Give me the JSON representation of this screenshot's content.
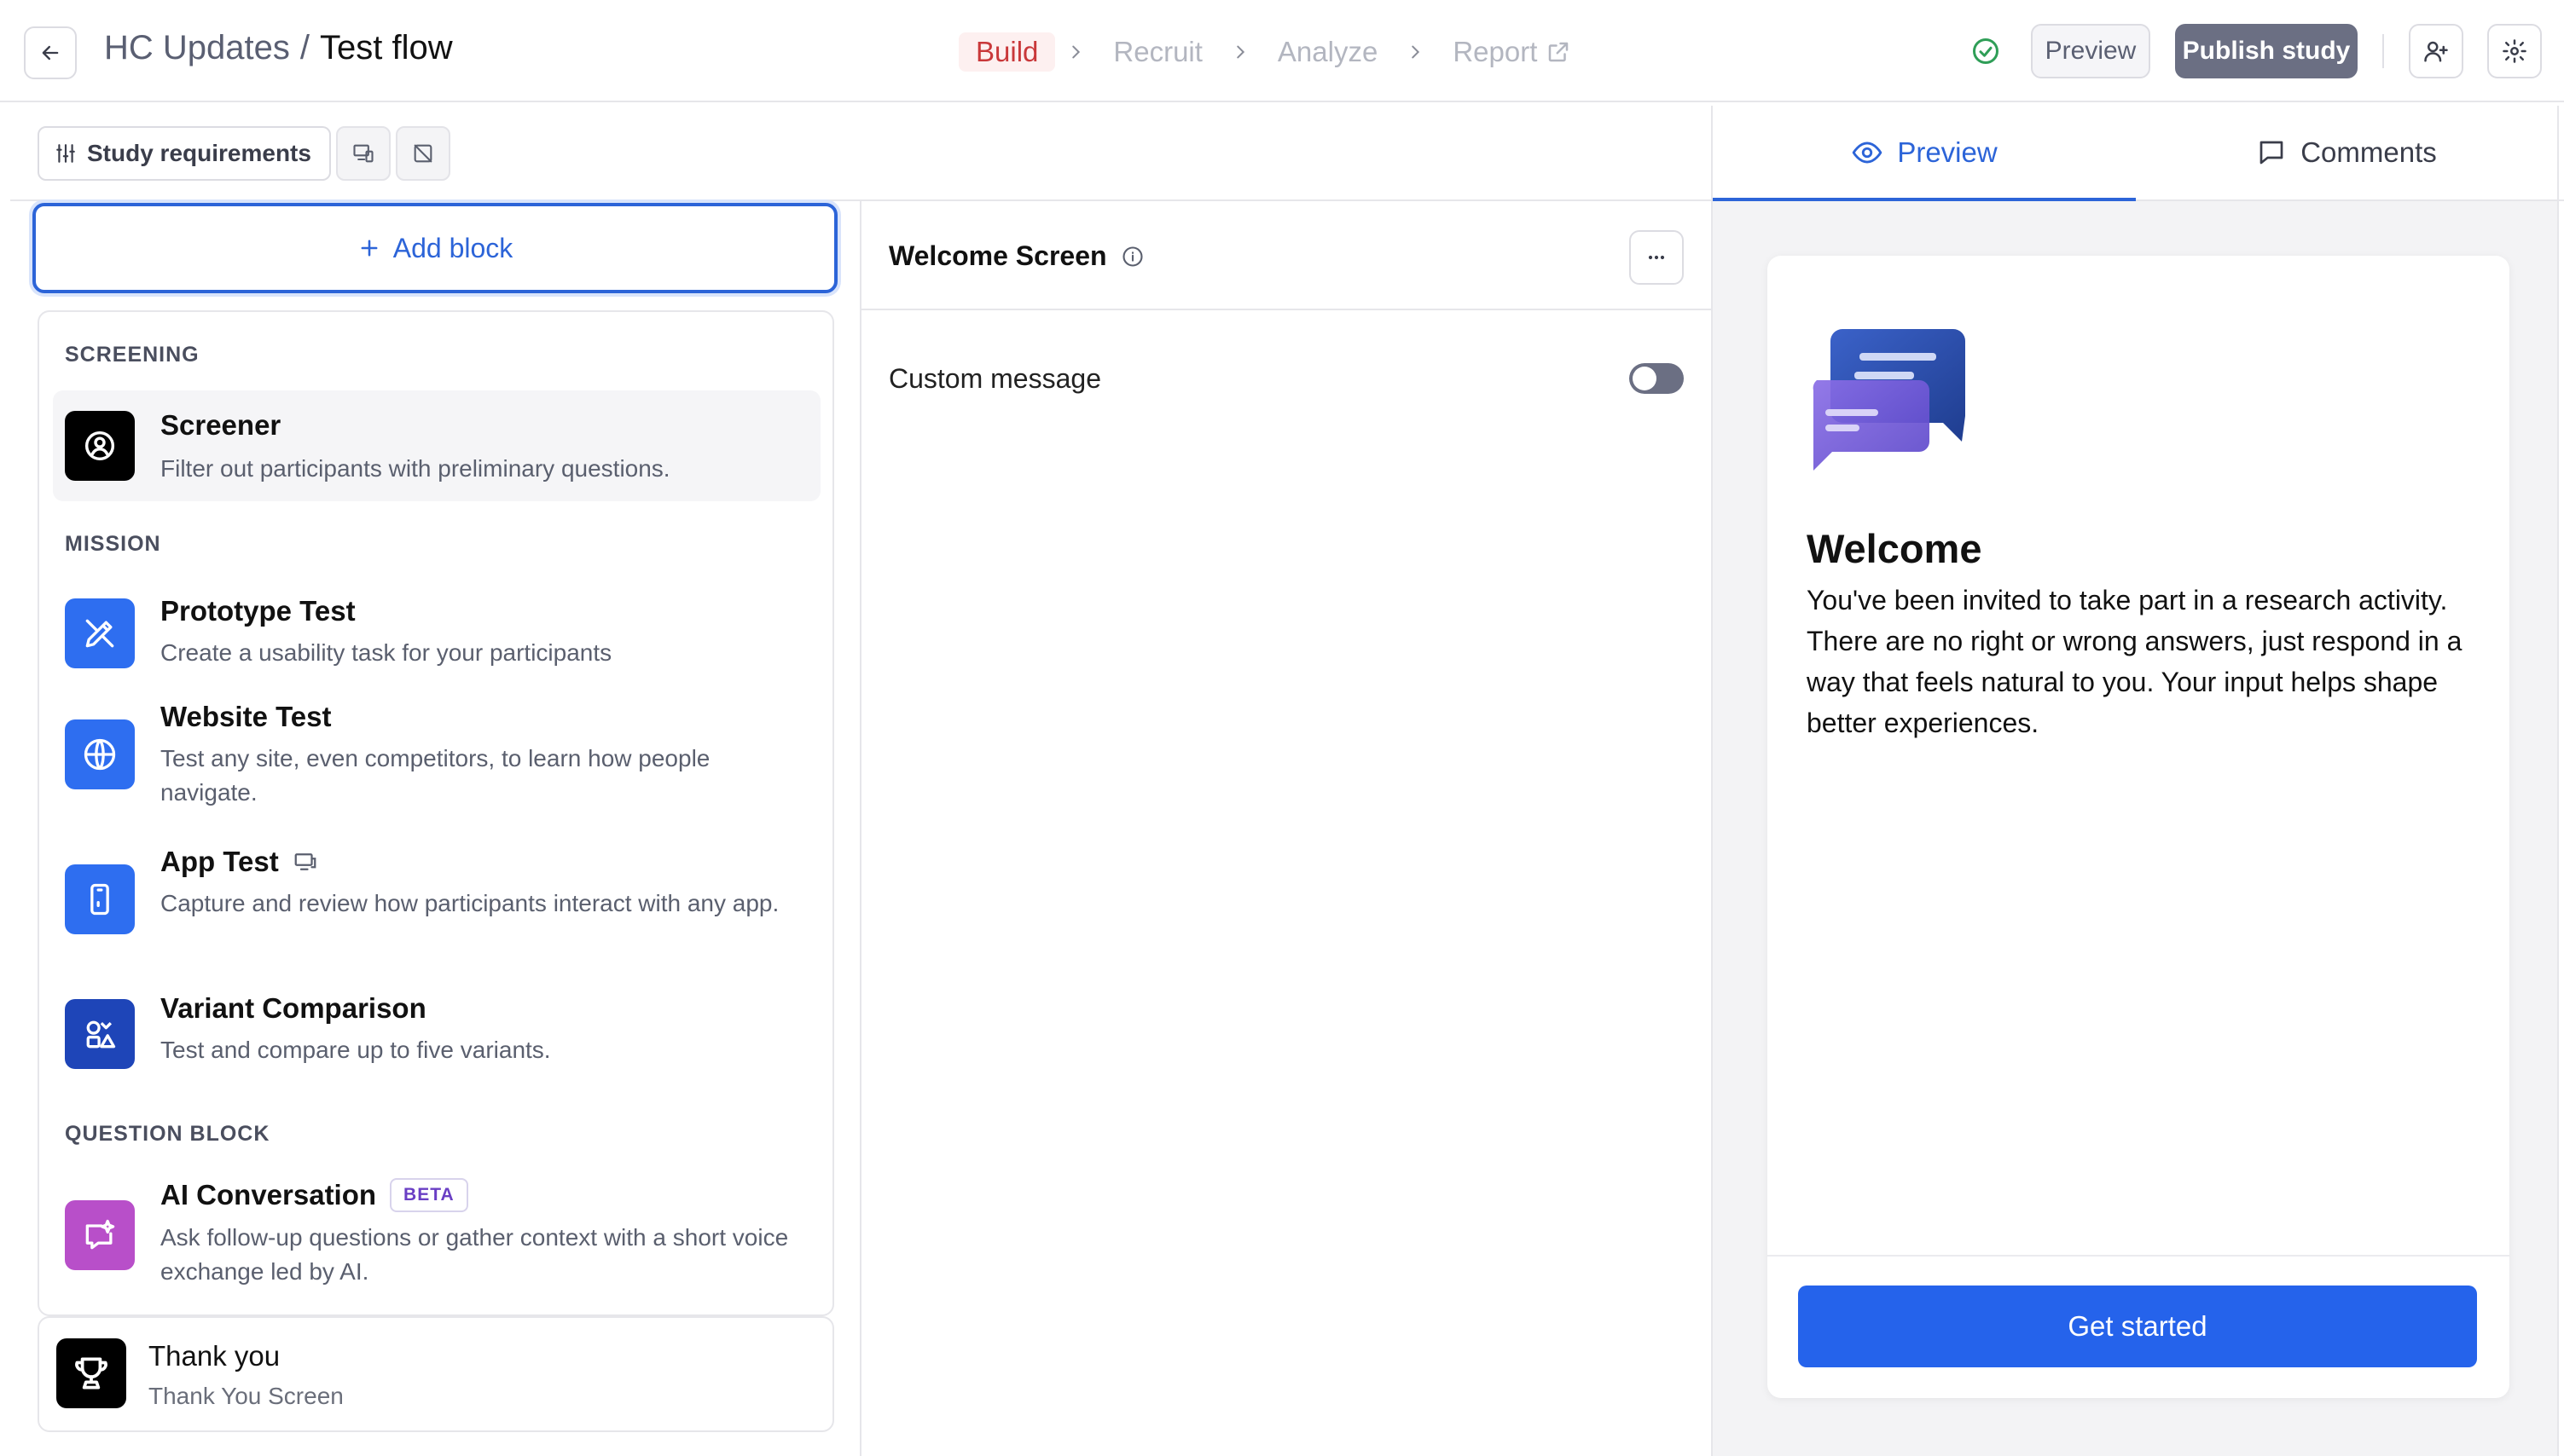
{
  "header": {
    "project": "HC Updates",
    "separator": "/",
    "flow": "Test flow",
    "steps": [
      {
        "label": "Build",
        "state": "active"
      },
      {
        "label": "Recruit",
        "state": "inactive"
      },
      {
        "label": "Analyze",
        "state": "inactive"
      },
      {
        "label": "Report",
        "state": "inactive"
      }
    ],
    "preview_label": "Preview",
    "publish_label": "Publish study",
    "icons": [
      "back-arrow-icon",
      "check-circle-icon",
      "external-link-icon",
      "add-user-icon",
      "gear-icon"
    ]
  },
  "toolbar": {
    "requirements_label": "Study requirements"
  },
  "add_block_label": "Add block",
  "blocks": {
    "sections": [
      {
        "title": "SCREENING",
        "items": [
          {
            "title": "Screener",
            "desc": "Filter out participants with preliminary questions.",
            "icon": "screener-icon",
            "color": "#000000"
          }
        ]
      },
      {
        "title": "MISSION",
        "items": [
          {
            "title": "Prototype Test",
            "desc": "Create a usability task for your participants",
            "icon": "prototype-icon",
            "color": "#2e6ef0"
          },
          {
            "title": "Website Test",
            "desc": "Test any site, even competitors, to learn how people navigate.",
            "icon": "globe-icon",
            "color": "#2e6ef0"
          },
          {
            "title": "App Test",
            "desc": "Capture and review how participants interact with any app.",
            "icon": "phone-icon",
            "color": "#2e6ef0"
          },
          {
            "title": "Variant Comparison",
            "desc": "Test and compare up to five variants.",
            "icon": "variants-icon",
            "color": "#1e45b8"
          }
        ]
      },
      {
        "title": "QUESTION BLOCK",
        "items": [
          {
            "title": "AI Conversation",
            "badge": "BETA",
            "desc": "Ask follow-up questions or gather context with a short voice exchange led by AI.",
            "icon": "ai-chat-icon",
            "color": "#b84fc9"
          }
        ]
      }
    ]
  },
  "thank_you": {
    "title": "Thank you",
    "subtitle": "Thank You Screen"
  },
  "editor": {
    "title": "Welcome Screen",
    "custom_message_label": "Custom message",
    "custom_message_enabled": false
  },
  "preview_panel": {
    "tabs": [
      {
        "label": "Preview",
        "active": true
      },
      {
        "label": "Comments",
        "active": false
      }
    ],
    "heading": "Welcome",
    "body": "You've been invited to take part in a research activity. There are no right or wrong answers, just respond in a way that feels natural to you. Your input helps shape better experiences.",
    "button_label": "Get started"
  },
  "colors": {
    "accent": "#2563eb",
    "build_active": "#c9383a",
    "publish_bg": "#6b6f83"
  }
}
